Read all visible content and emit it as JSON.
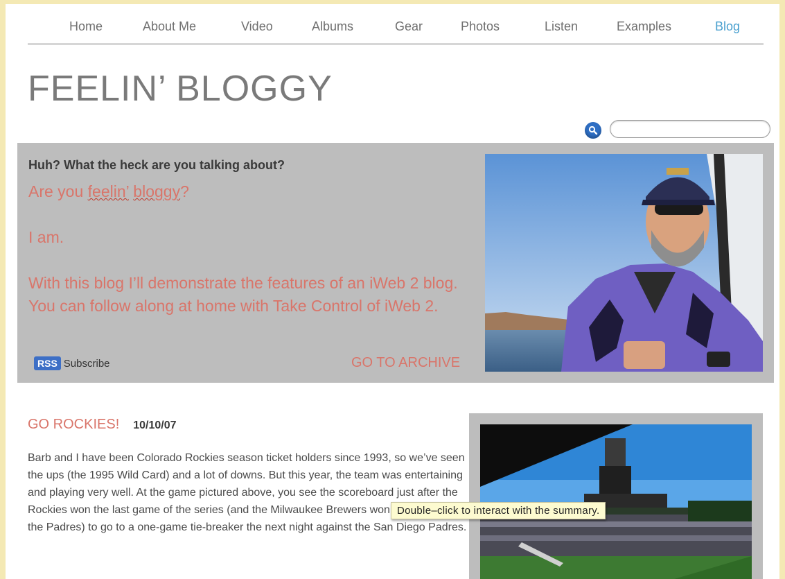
{
  "nav": {
    "items": [
      {
        "label": "Home"
      },
      {
        "label": "About Me"
      },
      {
        "label": "Video"
      },
      {
        "label": "Albums"
      },
      {
        "label": "Gear"
      },
      {
        "label": "Photos"
      },
      {
        "label": "Listen"
      },
      {
        "label": "Examples"
      },
      {
        "label": "Blog",
        "active": true
      }
    ]
  },
  "site_title": "FEELIN’ BLOGGY",
  "search": {
    "placeholder": "",
    "icon": "search-icon"
  },
  "summary": {
    "heading": "Huh? What the heck are you talking about?",
    "line1_a": "Are you ",
    "line1_b": "feelin’",
    "line1_c": " ",
    "line1_d": "bloggy",
    "line1_e": "?",
    "line2": "I am.",
    "line3": "With this blog I’ll demonstrate the features of an iWeb 2 blog. You can follow along at home with Take Control of iWeb 2.",
    "rss_badge": "RSS",
    "rss_label": "Subscribe",
    "archive_link": "GO TO ARCHIVE"
  },
  "post": {
    "title": "GO ROCKIES!",
    "date": "10/10/07",
    "body": "Barb and I have been Colorado Rockies season ticket holders since 1993, so we’ve seen the ups (the 1995 Wild Card) and a lot of downs. But this year, the team was entertaining and playing very well. At the game pictured above, you see the scoreboard just after the Rockies won the last game of the series (and the Milwaukee Brewers won theirs against the Padres) to go to a one-game tie-breaker the next night against the San Diego Padres."
  },
  "tooltip": "Double–click to interact with the summary.",
  "colors": {
    "outer_background": "#f4e9b4",
    "accent_text": "#d9756a",
    "active_nav": "#4aa0cf",
    "summary_box": "#bdbdbd"
  }
}
